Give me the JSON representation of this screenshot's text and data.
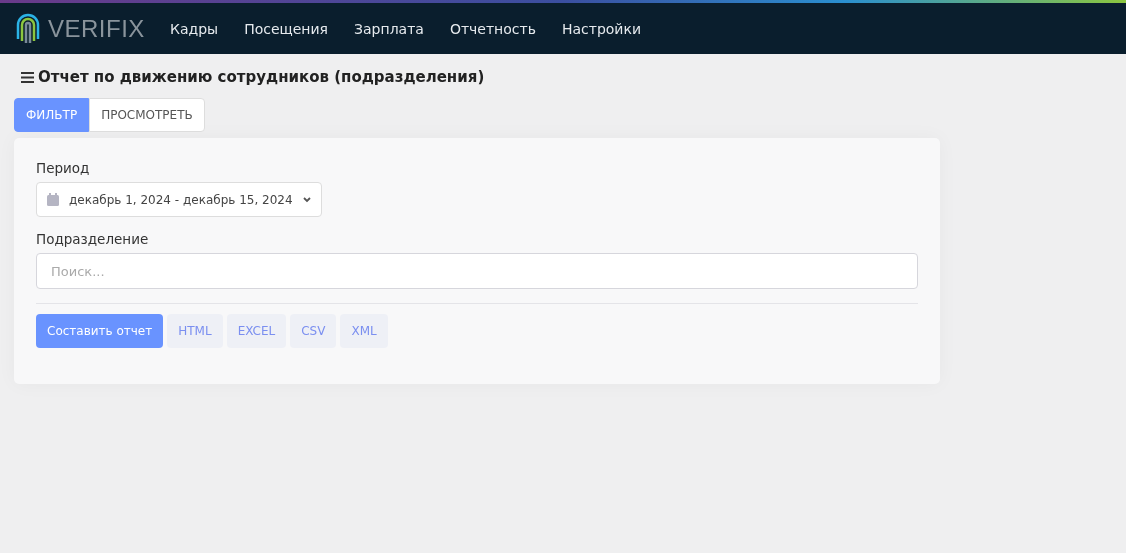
{
  "brand": {
    "name": "VERIFIX"
  },
  "nav": [
    "Кадры",
    "Посещения",
    "Зарплата",
    "Отчетность",
    "Настройки"
  ],
  "page": {
    "title": "Отчет по движению сотрудников (подразделения)"
  },
  "tabs": [
    {
      "label": "ФИЛЬТР",
      "selected": true
    },
    {
      "label": "ПРОСМОТРЕТЬ",
      "selected": false
    }
  ],
  "form": {
    "period": {
      "label": "Период",
      "value": "декабрь 1, 2024 - декабрь 15, 2024"
    },
    "division": {
      "label": "Подразделение",
      "placeholder": "Поиск..."
    },
    "buttons": [
      {
        "label": "Составить отчет",
        "kind": "primary"
      },
      {
        "label": "HTML",
        "kind": "export"
      },
      {
        "label": "EXCEL",
        "kind": "export"
      },
      {
        "label": "CSV",
        "kind": "export"
      },
      {
        "label": "XML",
        "kind": "export"
      }
    ]
  }
}
